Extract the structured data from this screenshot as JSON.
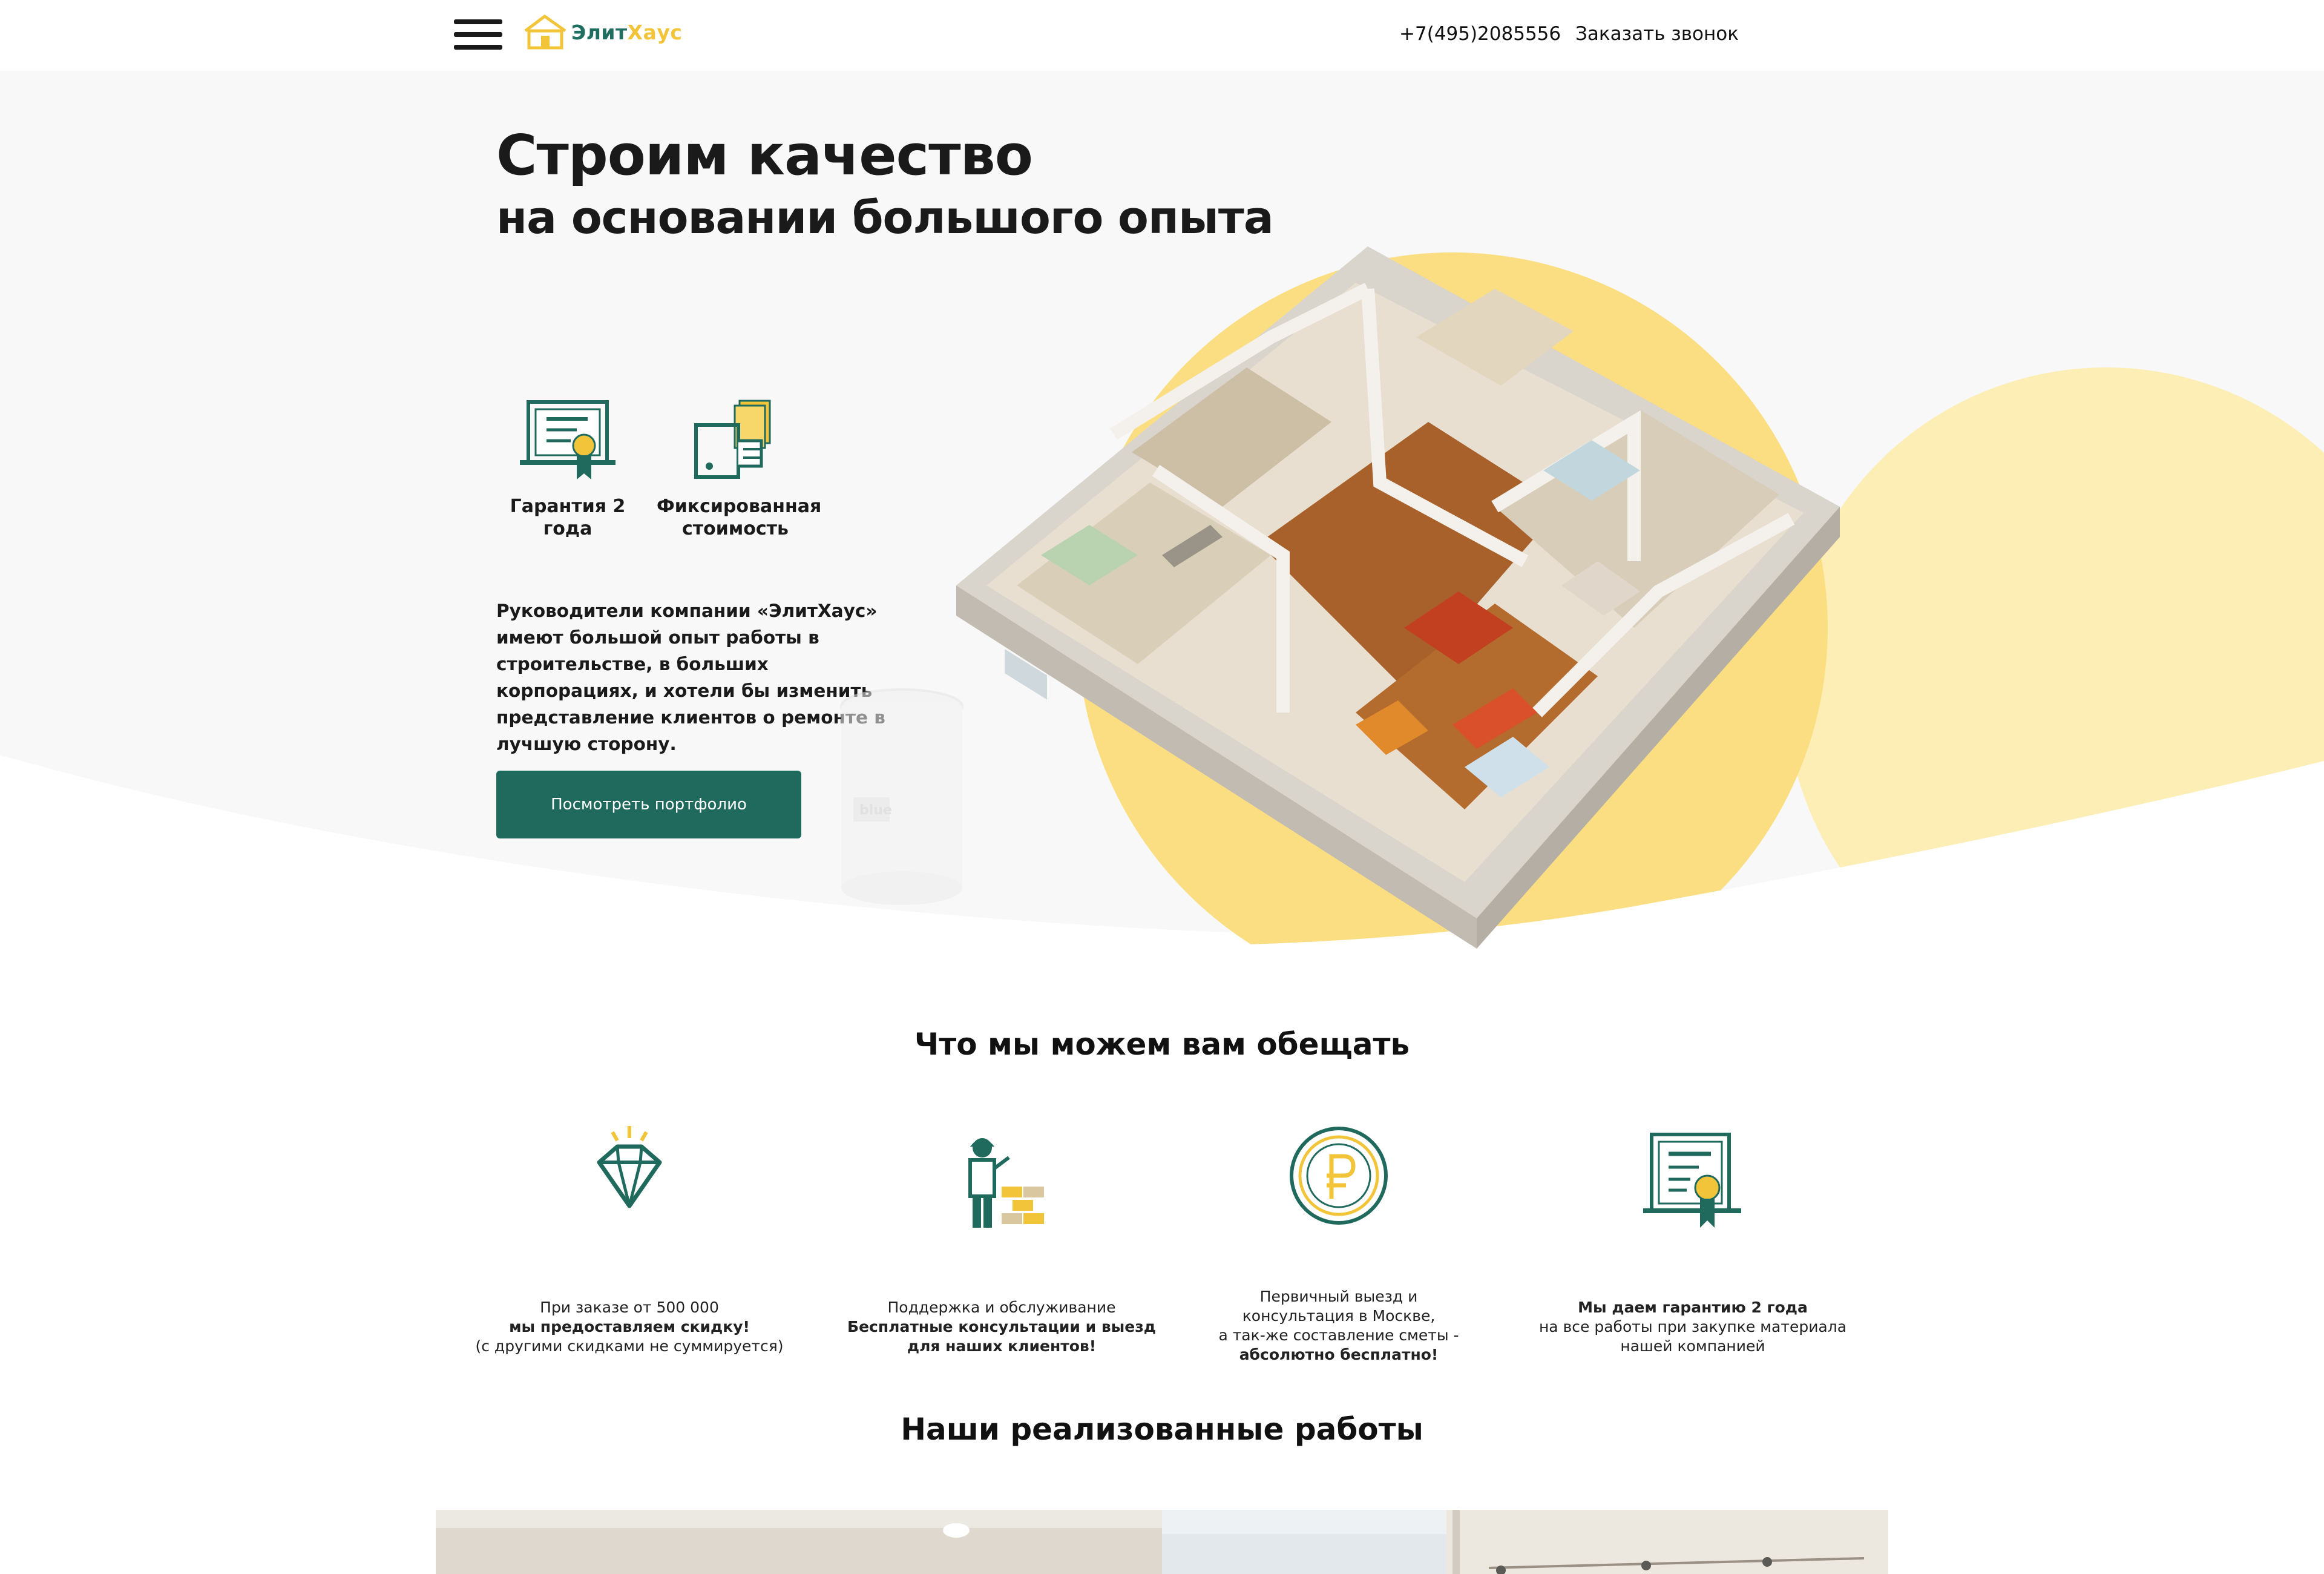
{
  "header": {
    "logo_part1": "Элит",
    "logo_part2": "Хаус",
    "phone": "+7(495)2085556",
    "callback_label": "Заказать звонок"
  },
  "hero": {
    "title_line1": "Строим качество",
    "title_line2": "на основании большого опыта",
    "features": [
      {
        "icon": "certificate-icon",
        "label": "Гарантия 2 года"
      },
      {
        "icon": "money-hand-icon",
        "label": "Фиксированная стоимость"
      }
    ],
    "description": "Руководители компании «ЭлитХаус» имеют большой опыт работы в строительстве, в больших корпорациях, и хотели бы изменить представление клиентов о ремонте в лучшую сторону.",
    "portfolio_button": "Посмотреть портфолио",
    "can_label": "blue"
  },
  "promises": {
    "title": "Что мы можем вам обещать",
    "items": [
      {
        "icon": "diamond-icon",
        "line1": "При заказе от 500 000",
        "line2": "мы предоставляем скидку!",
        "line3": "(с другими скидками не суммируется)"
      },
      {
        "icon": "builder-icon",
        "line1": "Поддержка и обслуживание",
        "line2": "Бесплатные консультации и выезд",
        "line3": "для наших клиентов!"
      },
      {
        "icon": "ruble-coin-icon",
        "line1": "Первичный выезд и",
        "line2": "консультация в Москве,",
        "line3": "а так-же составление сметы -",
        "line4": "абсолютно бесплатно!"
      },
      {
        "icon": "certificate-icon",
        "line1": "Мы даем гарантию 2 года",
        "line2": "на все работы при закупке материала",
        "line3": "нашей компанией"
      }
    ]
  },
  "works": {
    "title": "Наши реализованные работы"
  },
  "colors": {
    "accent_green": "#1f6a5d",
    "accent_yellow": "#f1c43a",
    "hero_bg": "#f8f8f8"
  }
}
